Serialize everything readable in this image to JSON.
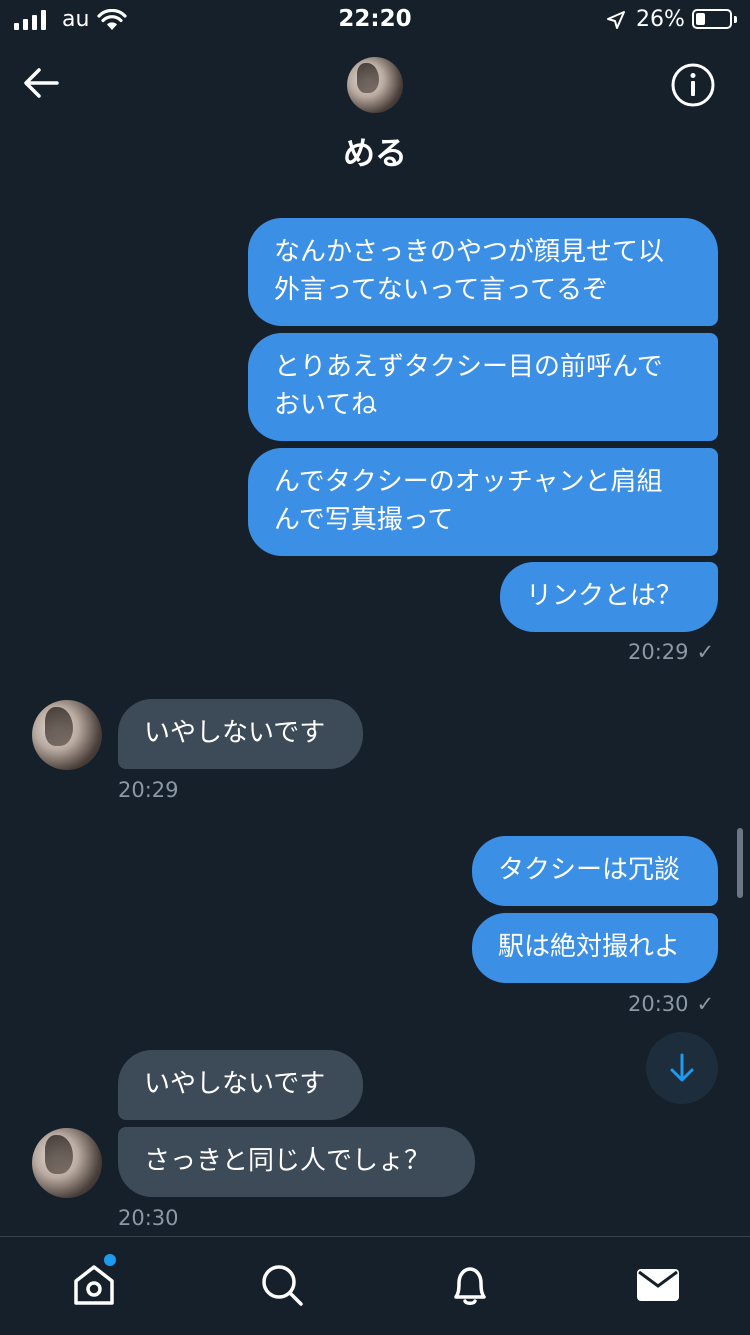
{
  "status_bar": {
    "carrier": "au",
    "time": "22:20",
    "battery_percent": "26%",
    "icons": [
      "signal-icon",
      "wifi-icon",
      "location-icon",
      "battery-icon"
    ]
  },
  "header": {
    "contact_name": "める",
    "back_icon": "arrow-left-icon",
    "info_icon": "info-icon"
  },
  "messages": [
    {
      "direction": "sent",
      "text": "なんかさっきのやつが顔見せて以\n外言ってないって言ってるぞ"
    },
    {
      "direction": "sent",
      "text": "とりあえずタクシー目の前呼んで\nおいてね"
    },
    {
      "direction": "sent",
      "text": "んでタクシーのオッチャンと肩組\nんで写真撮って"
    },
    {
      "direction": "sent",
      "text": "リンクとは？"
    },
    {
      "direction": "sent_time",
      "text": "20:29"
    },
    {
      "direction": "received",
      "text": "いやしないです"
    },
    {
      "direction": "received_time",
      "text": "20:29"
    },
    {
      "direction": "sent",
      "text": "タクシーは冗談"
    },
    {
      "direction": "sent",
      "text": "駅は絶対撮れよ"
    },
    {
      "direction": "sent_time",
      "text": "20:30"
    },
    {
      "direction": "received",
      "text": "いやしないです"
    },
    {
      "direction": "received",
      "text": "さっきと同じ人でしょ？"
    },
    {
      "direction": "received_time",
      "text": "20:30"
    }
  ],
  "read_mark": "✓",
  "tab_bar": {
    "items": [
      {
        "icon": "home-icon",
        "has_notification_dot": true
      },
      {
        "icon": "search-icon"
      },
      {
        "icon": "bell-icon"
      },
      {
        "icon": "mail-icon",
        "active": true
      }
    ]
  },
  "colors": {
    "background": "#15202b",
    "sent_bubble": "#3b8fe5",
    "received_bubble": "#3d4a58",
    "accent": "#1d9bf0",
    "timestamp": "#8b98a5"
  }
}
